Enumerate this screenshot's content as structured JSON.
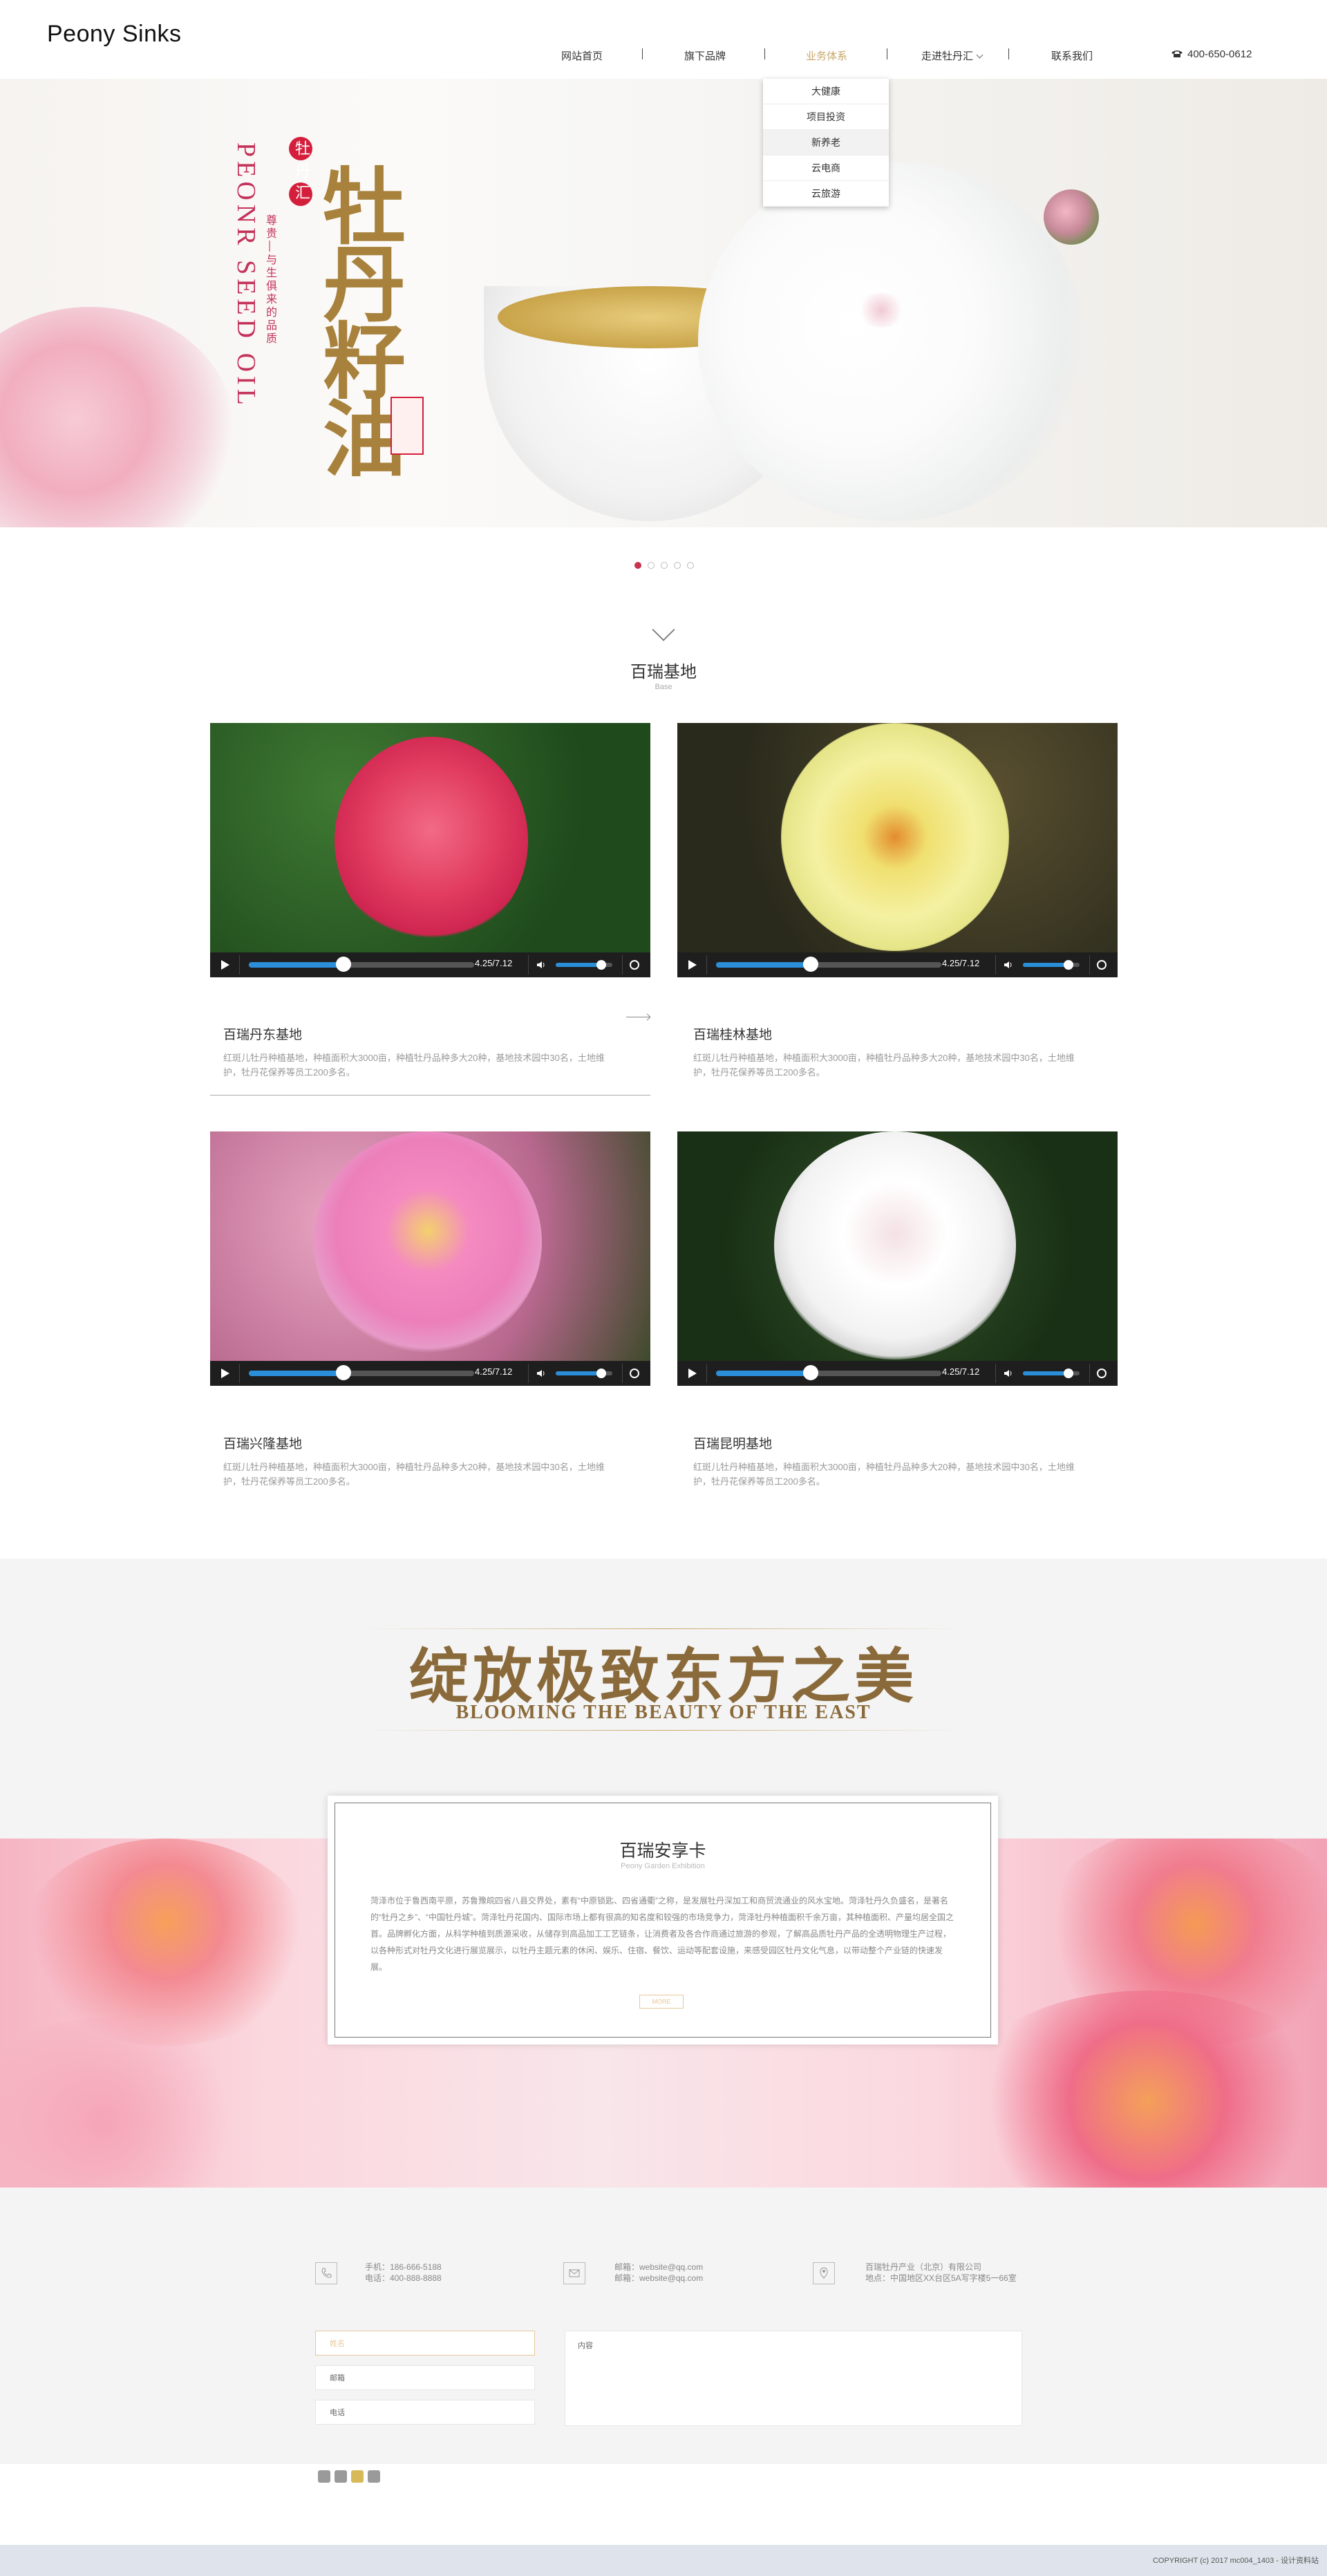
{
  "header": {
    "logo": "Peony Sinks",
    "nav": [
      "网站首页",
      "旗下品牌",
      "业务体系",
      "走进牡丹汇",
      "联系我们"
    ],
    "phone": "400-650-0612"
  },
  "dropdown": [
    "大健康",
    "项目投资",
    "新养老",
    "云电商",
    "云旅游"
  ],
  "hero": {
    "en": "PEONR SEED OIL",
    "cn_small": "尊贵—与生俱来的品质",
    "title": "牡丹籽油",
    "badge": "牡丹汇"
  },
  "section_base": {
    "title": "百瑞基地",
    "subtitle": "Base"
  },
  "video": {
    "time": "4.25/7.12",
    "progress": 0.42,
    "volume": 0.8
  },
  "cards": [
    {
      "title": "百瑞丹东基地",
      "desc": "红斑儿牡丹种植基地，种植面积大3000亩，种植牡丹品种多大20种，基地技术园中30名，土地维护，牡丹花保养等员工200多名。"
    },
    {
      "title": "百瑞桂林基地",
      "desc": "红斑儿牡丹种植基地，种植面积大3000亩，种植牡丹品种多大20种，基地技术园中30名，土地维护，牡丹花保养等员工200多名。"
    },
    {
      "title": "百瑞兴隆基地",
      "desc": "红斑儿牡丹种植基地，种植面积大3000亩，种植牡丹品种多大20种，基地技术园中30名，土地维护，牡丹花保养等员工200多名。"
    },
    {
      "title": "百瑞昆明基地",
      "desc": "红斑儿牡丹种植基地，种植面积大3000亩，种植牡丹品种多大20种，基地技术园中30名，土地维护，牡丹花保养等员工200多名。"
    }
  ],
  "bloom": {
    "cn": "绽放极致东方之美",
    "en": "BLOOMING THE BEAUTY OF THE EAST"
  },
  "card_box": {
    "title": "百瑞安享卡",
    "subtitle": "Peony Garden Exhibition",
    "text": "菏泽市位于鲁西南平原，苏鲁豫皖四省八县交界处，素有“中原锁匙、四省通衢”之称，是发展牡丹深加工和商贸流通业的风水宝地。菏泽牡丹久负盛名，是著名的“牡丹之乡”、“中国牡丹城”。菏泽牡丹花国内、国际市场上都有很高的知名度和较强的市场竞争力，菏泽牡丹种植面积千余万亩，其种植面积、产量均居全国之首。品牌孵化方面，从科学种植到质源采收，从储存到高品加工工艺链条，让消费者及各合作商通过旅游的参观，了解高品质牡丹产品的全透明物理生产过程，以各种形式对牡丹文化进行展览展示，以牡丹主题元素的休闲、娱乐、住宿、餐饮、运动等配套设施，来感受园区牡丹文化气息，以带动整个产业链的快速发展。",
    "button": "MORE"
  },
  "contact": {
    "phone": [
      "手机：186-666-5188",
      "电话：400-888-8888"
    ],
    "email": [
      "邮箱：website@qq.com",
      "邮箱：website@qq.com"
    ],
    "address": [
      "百瑞牡丹产业（北京）有限公司",
      "地点：中国地区XX台区5A写字楼5一66室"
    ],
    "fields": [
      "姓名",
      "邮箱",
      "电话"
    ],
    "textarea": "内容"
  },
  "footer": {
    "copyright": "COPYRIGHT (c) 2017 mc004_1403 - 设计资料站"
  }
}
